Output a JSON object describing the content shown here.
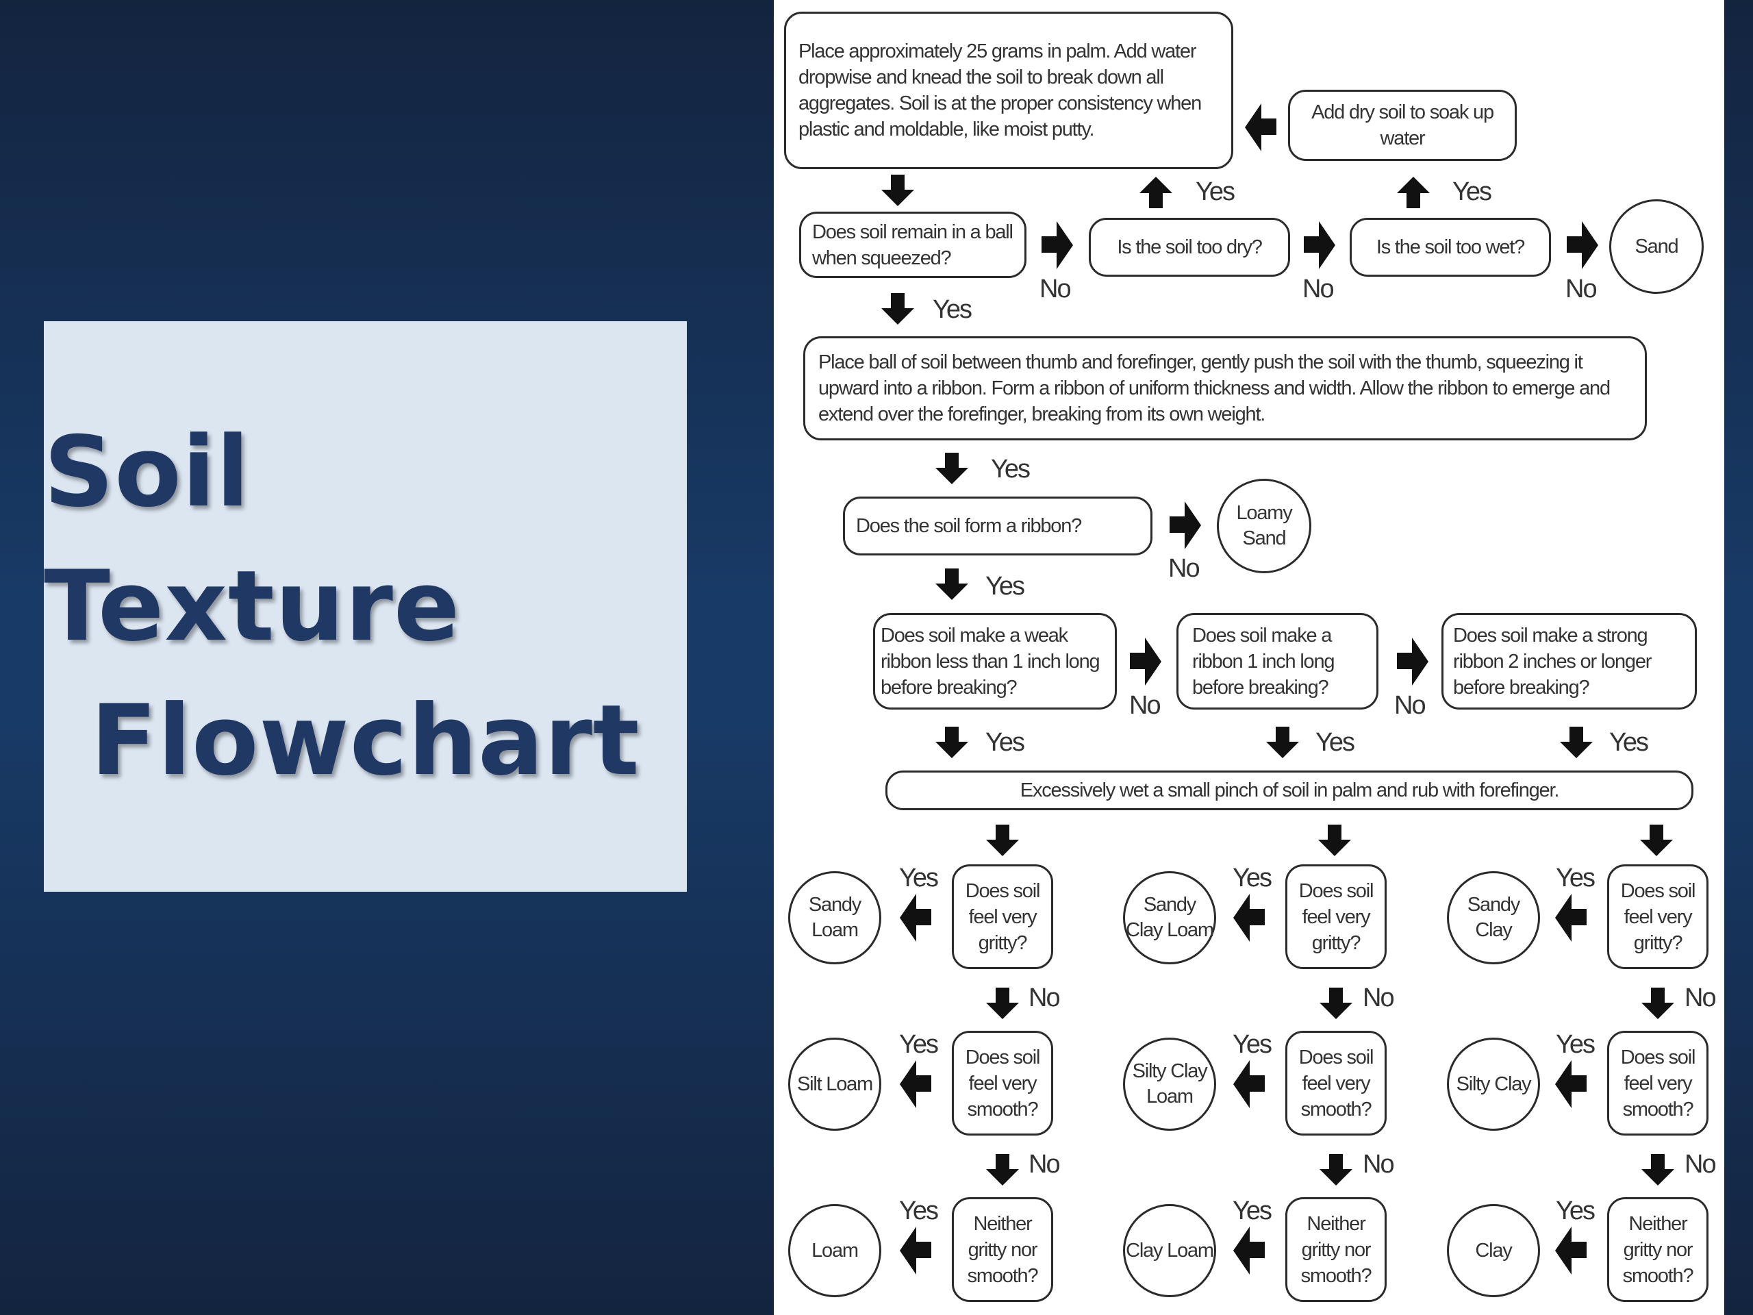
{
  "slide": {
    "title_lines": [
      "Soil Texture",
      "Flowchart"
    ],
    "colors": {
      "background": "#183a66",
      "title_card": "#dce6f1",
      "title_text": "#1f3864",
      "panel": "#ffffff",
      "node_border": "#2b2b2b",
      "node_text": "#333333"
    }
  },
  "flowchart": {
    "start": "Place approximately 25 grams in palm. Add water dropwise and knead the soil to break down all aggregates. Soil is at the proper consistency when plastic and moldable, like moist putty.",
    "add_dry_soil": "Add dry soil to soak up water",
    "ball_question": "Does soil remain in a ball when squeezed?",
    "too_dry_question": "Is the soil too dry?",
    "too_wet_question": "Is the soil too wet?",
    "sand": "Sand",
    "ribbon_instruction": "Place ball of soil between thumb and forefinger, gently push the soil with the thumb, squeezing it upward into a ribbon. Form a ribbon of uniform thickness and width. Allow the ribbon to emerge and extend over the forefinger, breaking from its own weight.",
    "ribbon_question": "Does the soil form a ribbon?",
    "loamy_sand": "Loamy Sand",
    "weak_ribbon_question": "Does soil make a weak ribbon less than 1 inch long before breaking?",
    "medium_ribbon_question": "Does soil make a ribbon 1 inch long before breaking?",
    "strong_ribbon_question": "Does soil make a strong ribbon 2 inches or longer before breaking?",
    "wet_instruction": "Excessively wet a small pinch of soil in palm and rub with forefinger.",
    "labels": {
      "yes": "Yes",
      "no": "No"
    },
    "columns": [
      {
        "gritty_question": "Does soil feel very gritty?",
        "gritty_result": "Sandy Loam",
        "smooth_question": "Does soil feel very smooth?",
        "smooth_result": "Silt Loam",
        "neither_question": "Neither gritty nor smooth?",
        "neither_result": "Loam"
      },
      {
        "gritty_question": "Does soil feel very gritty?",
        "gritty_result": "Sandy Clay Loam",
        "smooth_question": "Does soil feel very smooth?",
        "smooth_result": "Silty Clay Loam",
        "neither_question": "Neither gritty nor smooth?",
        "neither_result": "Clay Loam"
      },
      {
        "gritty_question": "Does soil feel very gritty?",
        "gritty_result": "Sandy Clay",
        "smooth_question": "Does soil feel very smooth?",
        "smooth_result": "Silty Clay",
        "neither_question": "Neither gritty nor smooth?",
        "neither_result": "Clay"
      }
    ]
  }
}
